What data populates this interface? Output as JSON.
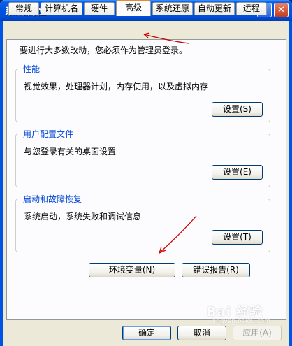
{
  "window": {
    "title": "系统属性",
    "help_label": "?",
    "close_label": "✕"
  },
  "tabs": [
    {
      "label": "常规"
    },
    {
      "label": "计算机名"
    },
    {
      "label": "硬件"
    },
    {
      "label": "高级",
      "active": true
    },
    {
      "label": "系统还原"
    },
    {
      "label": "自动更新"
    },
    {
      "label": "远程"
    }
  ],
  "intro_text": "要进行大多数改动，您必须作为管理员登录。",
  "groups": {
    "performance": {
      "title": "性能",
      "text": "视觉效果，处理器计划，内存使用，以及虚拟内存",
      "button": "设置(S)"
    },
    "profiles": {
      "title": "用户配置文件",
      "text": "与您登录有关的桌面设置",
      "button": "设置(E)"
    },
    "startup": {
      "title": "启动和故障恢复",
      "text": "系统启动，系统失败和调试信息",
      "button": "设置(T)"
    }
  },
  "env_button": "环境变量(N)",
  "error_button": "错误报告(R)",
  "footer": {
    "ok": "确定",
    "cancel": "取消",
    "apply": "应用(A)"
  },
  "watermark": {
    "brand": "Bai 经验",
    "url": "jingyan.baidu.com"
  },
  "colors": {
    "title_bar": "#0054e3",
    "group_title": "#0046d5",
    "annotation_arrow": "#cc0000",
    "active_tab_accent": "#e68b2c"
  }
}
